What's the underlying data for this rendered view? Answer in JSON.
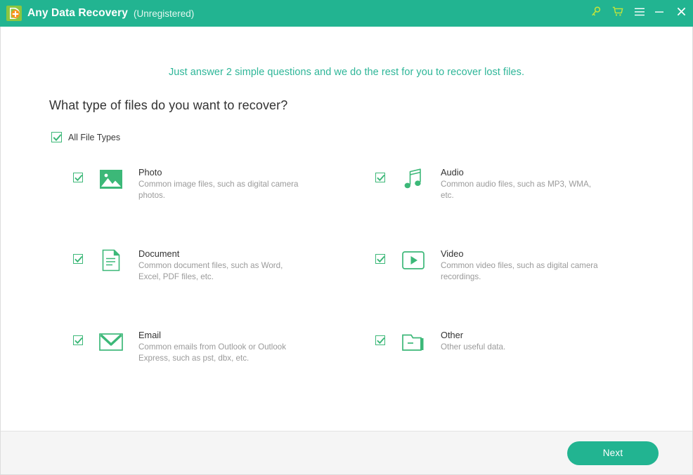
{
  "colors": {
    "brand_green": "#22b491",
    "accent_green": "#2eb698",
    "icon_green": "#3cb878",
    "key_yellow": "#c5e539",
    "footer_bg": "#f5f5f5",
    "text_dark": "#333333",
    "text_muted": "#9a9a9a"
  },
  "titlebar": {
    "logo_icon": "app-logo-d-plus-icon",
    "app_name": "Any Data Recovery",
    "registration_status": "(Unregistered)",
    "buttons": [
      {
        "name": "key-icon",
        "label": "Register"
      },
      {
        "name": "cart-icon",
        "label": "Buy"
      },
      {
        "name": "menu-icon",
        "label": "Menu"
      },
      {
        "name": "minimize-icon",
        "label": "Minimize"
      },
      {
        "name": "close-icon",
        "label": "Close"
      }
    ]
  },
  "main": {
    "intro_text": "Just answer 2 simple questions and we do the rest for you to recover lost files.",
    "question": "What type of files do you want to recover?",
    "all_file_types": {
      "label": "All File Types",
      "checked": true
    },
    "file_types": [
      {
        "id": "photo",
        "title": "Photo",
        "description": "Common image files, such as digital camera photos.",
        "checked": true,
        "icon": "photo-icon"
      },
      {
        "id": "audio",
        "title": "Audio",
        "description": "Common audio files, such as MP3, WMA, etc.",
        "checked": true,
        "icon": "audio-icon"
      },
      {
        "id": "document",
        "title": "Document",
        "description": "Common document files, such as Word, Excel, PDF files, etc.",
        "checked": true,
        "icon": "document-icon"
      },
      {
        "id": "video",
        "title": "Video",
        "description": "Common video files, such as digital camera recordings.",
        "checked": true,
        "icon": "video-icon"
      },
      {
        "id": "email",
        "title": "Email",
        "description": "Common emails from Outlook or Outlook Express, such as pst, dbx, etc.",
        "checked": true,
        "icon": "email-icon"
      },
      {
        "id": "other",
        "title": "Other",
        "description": "Other useful data.",
        "checked": true,
        "icon": "other-folder-icon"
      }
    ]
  },
  "footer": {
    "next_label": "Next"
  }
}
